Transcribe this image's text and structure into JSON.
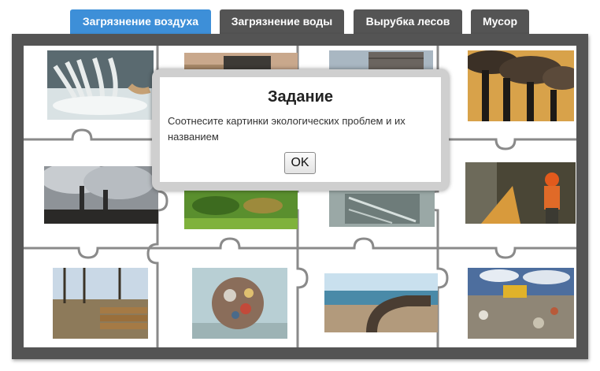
{
  "tabs": [
    {
      "label": "Загрязнение воздуха",
      "active": true
    },
    {
      "label": "Загрязнение воды",
      "active": false
    },
    {
      "label": "Вырубка лесов",
      "active": false
    },
    {
      "label": "Мусор",
      "active": false
    }
  ],
  "dialog": {
    "title": "Задание",
    "text": "Соотнесите картинки экологических проблем и их названием",
    "ok_label": "OK"
  },
  "pictures": [
    {
      "id": "factory-waste-water"
    },
    {
      "id": "shore-pollution"
    },
    {
      "id": "industrial-dump-truck"
    },
    {
      "id": "factory-chimney-smoke"
    },
    {
      "id": "power-plant-smog"
    },
    {
      "id": "green-aerial-forest"
    },
    {
      "id": "polluted-water-pipe"
    },
    {
      "id": "chainsaw-logging"
    },
    {
      "id": "felled-logs"
    },
    {
      "id": "trash-ball"
    },
    {
      "id": "sewage-pipe-beach"
    },
    {
      "id": "landfill-bulldozer"
    }
  ],
  "colors": {
    "active_tab": "#3d8fd8",
    "inactive_tab": "#545454",
    "frame": "#545454"
  }
}
